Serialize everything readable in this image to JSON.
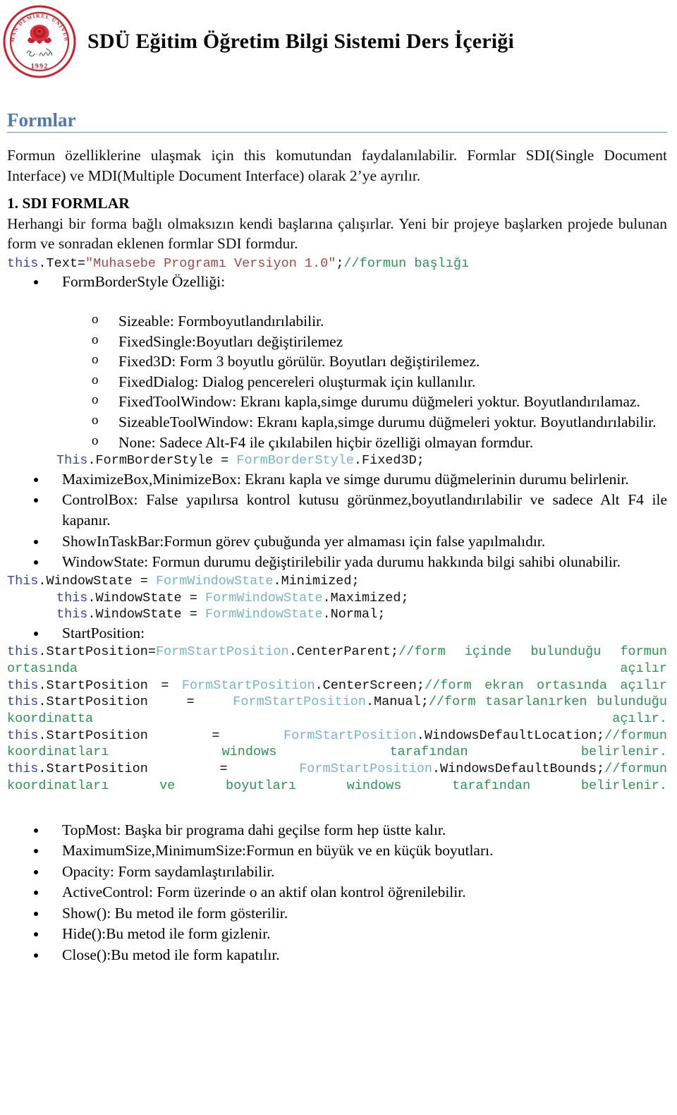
{
  "header": {
    "logo_alt": "Süleyman Demirel Üniversitesi logo",
    "logo_ring_top": "SÜLEYMAN DEMİREL",
    "logo_ring_bottom": "ÜNİVERSİTESİ",
    "logo_year": "1992",
    "logo_signature": "S. Demirel",
    "title": "SDÜ Eğitim Öğretim Bilgi Sistemi Ders İçeriği",
    "brand_color": "#cf1f2e"
  },
  "section": {
    "heading": "Formlar",
    "heading_color": "#4f7ab0",
    "rule_color": "#6f93c0"
  },
  "intro": {
    "paragraph": "Formun özelliklerine ulaşmak için this komutundan faydalanılabilir. Formlar SDI(Single Document Interface) ve MDI(Multiple Document Interface)  olarak 2’ye ayrılır."
  },
  "sdi": {
    "heading": "1. SDI FORMLAR",
    "paragraph": "Herhangi bir forma bağlı olmaksızın kendi başlarına çalışırlar. Yeni bir projeye başlarken projede bulunan form ve sonradan eklenen formlar SDI formdur."
  },
  "code_text_title": {
    "kw": "this",
    "member": ".Text=",
    "string": "\"Muhasebe Programı Versiyon 1.0\"",
    "semicolon": ";",
    "comment": "//formun başlığı"
  },
  "bullets_formborderstyle": {
    "label": "FormBorderStyle Özelliği:"
  },
  "formborderstyle_options": [
    "Sizeable: Formboyutlandırılabilir.",
    "FixedSingle:Boyutları değiştirilemez",
    "Fixed3D: Form 3 boyutlu görülür. Boyutları değiştirilemez.",
    "FixedDialog: Dialog pencereleri oluşturmak için kullanılır.",
    "FixedToolWindow: Ekranı kapla,simge durumu düğmeleri yoktur. Boyutlandırılamaz.",
    "SizeableToolWindow: Ekranı kapla,simge durumu düğmeleri yoktur. Boyutlandırılabilir.",
    "None: Sadece Alt-F4 ile çıkılabilen hiçbir özelliği olmayan formdur."
  ],
  "code_formborderstyle": {
    "kw": "This",
    "member": ".FormBorderStyle = ",
    "type": "FormBorderStyle",
    "value": ".Fixed3D;"
  },
  "bullets_properties": [
    "MaximizeBox,MinimizeBox: Ekranı kapla ve simge durumu düğmelerinin durumu belirlenir.",
    "ControlBox: False yapılırsa kontrol kutusu görünmez,boyutlandırılabilir ve sadece Alt F4 ile kapanır.",
    "ShowInTaskBar:Formun  görev çubuğunda yer almaması için false yapılmalıdır.",
    "WindowState: Formun durumu değiştirilebilir yada durumu hakkında bilgi sahibi olunabilir."
  ],
  "code_windowstate": [
    {
      "kw": "This",
      "member": ".WindowState = ",
      "type": "FormWindowState",
      "value": ".Minimized;",
      "indent": 0
    },
    {
      "kw": "this",
      "member": ".WindowState = ",
      "type": "FormWindowState",
      "value": ".Maximized;",
      "indent": 1
    },
    {
      "kw": "this",
      "member": ".WindowState = ",
      "type": "FormWindowState",
      "value": ".Normal;",
      "indent": 1
    }
  ],
  "bullet_startposition": {
    "label": "StartPosition:"
  },
  "code_startposition": [
    {
      "kw": "this",
      "member": ".StartPosition=",
      "type": "FormStartPosition",
      "value": ".CenterParent;",
      "comment": "//form içinde bulunduğu formun ortasında açılır"
    },
    {
      "kw": "this",
      "member": ".StartPosition = ",
      "type": "FormStartPosition",
      "value": ".CenterScreen;",
      "comment": "//form ekran ortasında açılır"
    },
    {
      "kw": "this",
      "member": ".StartPosition    =    ",
      "type": "FormStartPosition",
      "value": ".Manual;",
      "comment": "//form tasarlanırken bulunduğu koordinatta açılır."
    },
    {
      "kw": "this",
      "member": ".StartPosition    =    ",
      "type": "FormStartPosition",
      "value": ".WindowsDefaultLocation;",
      "comment": "//formun koordinatları windows tarafından belirlenir."
    },
    {
      "kw": "this",
      "member": ".StartPosition    =    ",
      "type": "FormStartPosition",
      "value": ".WindowsDefaultBounds;",
      "comment": "//formun koordinatları ve boyutları windows tarafından belirlenir."
    }
  ],
  "bullets_final": [
    "TopMost: Başka bir programa dahi geçilse form hep üstte kalır.",
    "MaximumSize,MinimumSize:Formun en büyük ve en küçük boyutları.",
    "Opacity: Form saydamlaştırılabilir.",
    "ActiveControl: Form üzerinde o an aktif olan kontrol öğrenilebilir.",
    "Show(): Bu metod ile form gösterilir.",
    "Hide():Bu metod ile form gizlenir.",
    "Close():Bu metod ile form kapatılır."
  ],
  "code_colors": {
    "keyword": "#3b43b0",
    "type": "#76b4c9",
    "string": "#a14a45",
    "comment": "#2f9155",
    "plain": "#111111"
  }
}
